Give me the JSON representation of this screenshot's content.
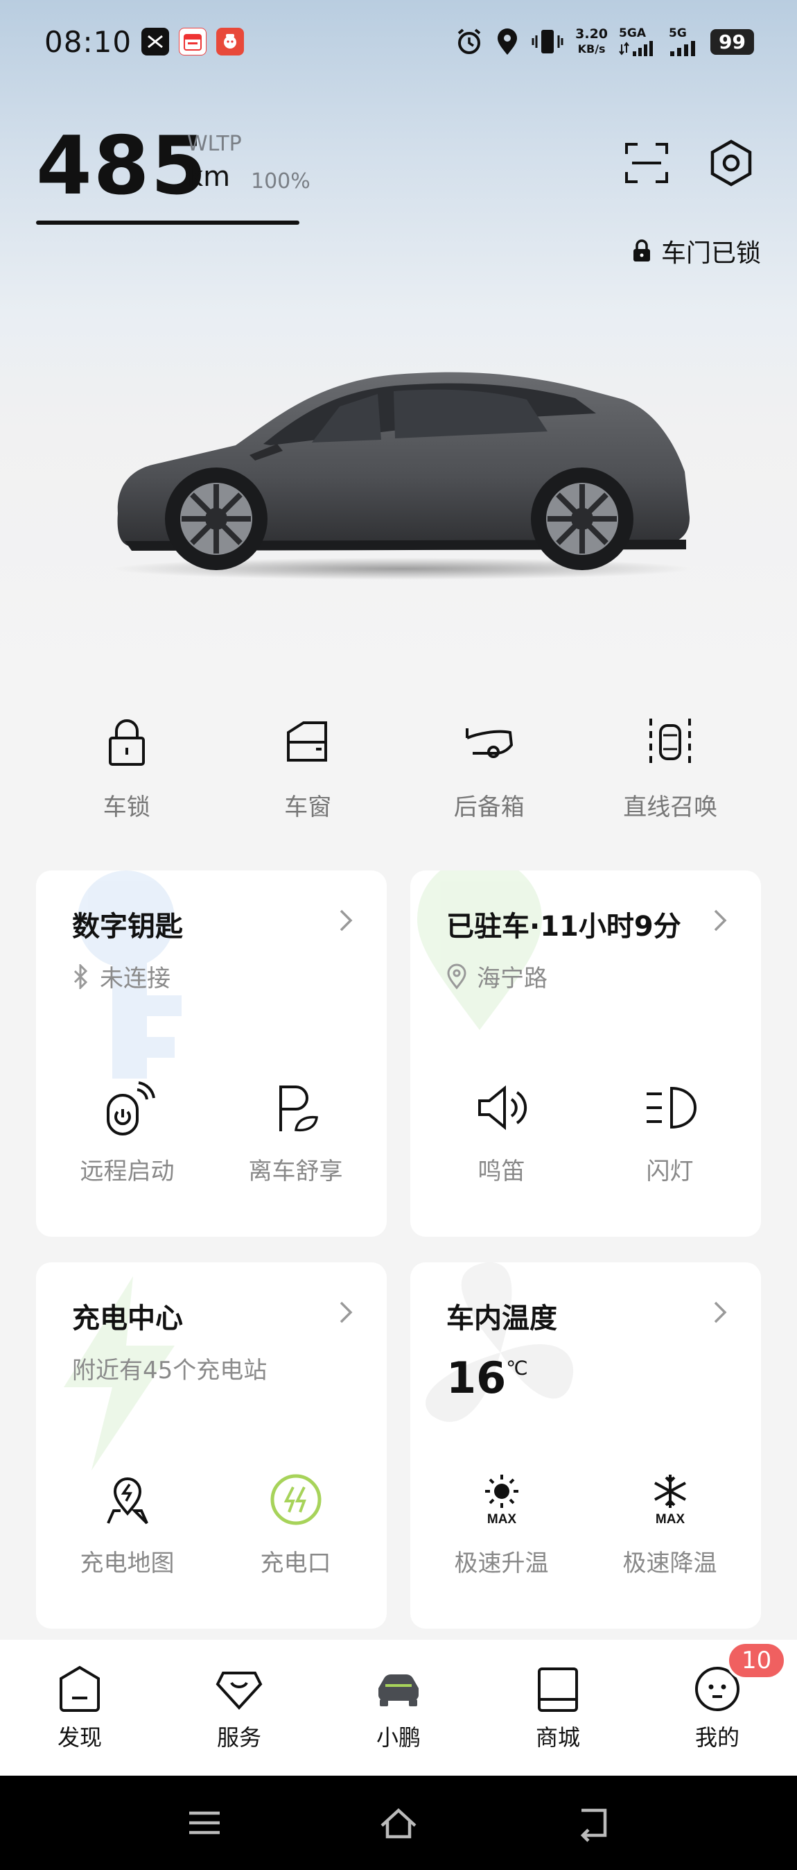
{
  "status_bar": {
    "time": "08:10",
    "speed_value": "3.20",
    "speed_unit": "KB/s",
    "net1": "5GA",
    "net2": "5G",
    "battery": "99"
  },
  "range": {
    "value": "485",
    "standard": "WLTP",
    "unit": "km",
    "battery_percent": "100%"
  },
  "lock_status": "车门已锁",
  "quick_actions": [
    {
      "label": "车锁",
      "icon": "lock-icon"
    },
    {
      "label": "车窗",
      "icon": "window-icon"
    },
    {
      "label": "后备箱",
      "icon": "trunk-icon"
    },
    {
      "label": "直线召唤",
      "icon": "summon-icon"
    }
  ],
  "cards": {
    "digital_key": {
      "title": "数字钥匙",
      "status": "未连接",
      "actions": [
        {
          "label": "远程启动"
        },
        {
          "label": "离车舒享"
        }
      ]
    },
    "parked": {
      "title": "已驻车·11小时9分",
      "location": "海宁路",
      "actions": [
        {
          "label": "鸣笛"
        },
        {
          "label": "闪灯"
        }
      ]
    },
    "charging": {
      "title": "充电中心",
      "subtitle": "附近有45个充电站",
      "actions": [
        {
          "label": "充电地图"
        },
        {
          "label": "充电口"
        }
      ]
    },
    "cabin_temp": {
      "title": "车内温度",
      "temperature": "16",
      "temp_unit": "℃",
      "actions": [
        {
          "label": "极速升温",
          "badge": "MAX"
        },
        {
          "label": "极速降温",
          "badge": "MAX"
        }
      ]
    }
  },
  "tabbar": {
    "tabs": [
      {
        "label": "发现"
      },
      {
        "label": "服务"
      },
      {
        "label": "小鹏"
      },
      {
        "label": "商城"
      },
      {
        "label": "我的"
      }
    ],
    "badge": "10"
  },
  "colors": {
    "accent_green": "#a7d35a",
    "badge_red": "#f06060"
  }
}
